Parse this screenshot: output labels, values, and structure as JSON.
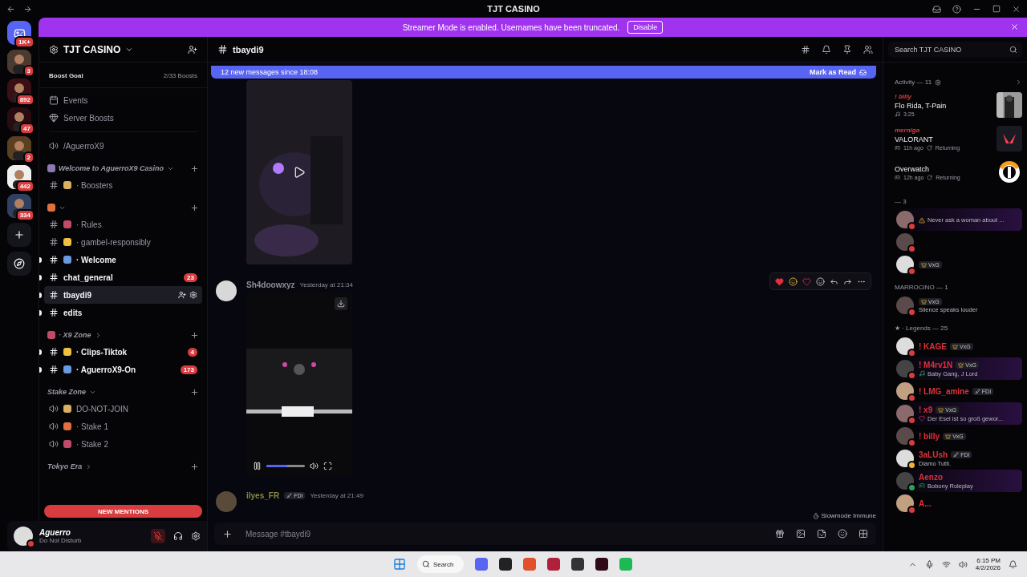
{
  "title_bar": {
    "title": "TJT CASINO"
  },
  "servers": [
    {
      "kind": "home",
      "badge": "1K+"
    },
    {
      "kind": "server",
      "badge": "3"
    },
    {
      "kind": "server",
      "badge": "892"
    },
    {
      "kind": "server",
      "badge": "47"
    },
    {
      "kind": "server",
      "badge": "2"
    },
    {
      "kind": "server",
      "badge": "442"
    },
    {
      "kind": "server",
      "badge": "334"
    },
    {
      "kind": "add"
    },
    {
      "kind": "discover"
    }
  ],
  "banner": {
    "text": "Streamer Mode is enabled. Usernames have been truncated.",
    "button": "Disable"
  },
  "sidebar": {
    "server_name": "TJT CASINO",
    "boost_goal": {
      "label": "Boost Goal",
      "count": "2/33 Boosts"
    },
    "items": [
      {
        "kind": "events",
        "name": "Events"
      },
      {
        "kind": "boosts",
        "name": "Server Boosts"
      },
      {
        "kind": "divider"
      },
      {
        "kind": "stage",
        "name": "/AguerroX9"
      },
      {
        "kind": "category",
        "name": "Welcome to AguerroX9 Casino",
        "emoji": true,
        "expanded": true
      },
      {
        "kind": "text",
        "name": "· Boosters",
        "emoji": true,
        "unread": false,
        "selected": false
      },
      {
        "kind": "category",
        "emoji": true,
        "expanded": true
      },
      {
        "kind": "text",
        "name": "· Rules",
        "emoji": true,
        "unread": false,
        "selected": false
      },
      {
        "kind": "text",
        "name": "· gambel-responsibly",
        "emoji": true,
        "unread": false,
        "selected": false
      },
      {
        "kind": "text",
        "name": "· Welcome",
        "emoji": true,
        "unread": true,
        "selected": false
      },
      {
        "kind": "text",
        "name": "chat_general",
        "emoji": false,
        "unread": true,
        "selected": false,
        "badge": "23"
      },
      {
        "kind": "text",
        "name": "tbaydi9",
        "emoji": false,
        "unread": true,
        "selected": true
      },
      {
        "kind": "text",
        "name": "edits",
        "emoji": false,
        "unread": true,
        "selected": false
      },
      {
        "kind": "category",
        "name": "· X9 Zone",
        "emoji": true,
        "expanded": false
      },
      {
        "kind": "text",
        "name": "· Clips-Tiktok",
        "emoji": true,
        "unread": true,
        "selected": false,
        "badge": "4"
      },
      {
        "kind": "text",
        "name": "· AguerroX9-On",
        "emoji": true,
        "unread": true,
        "selected": false,
        "badge": "173"
      },
      {
        "kind": "category",
        "name": "Stake Zone",
        "emoji": false,
        "expanded": true
      },
      {
        "kind": "voice",
        "name": "DO-NOT-JOIN",
        "emoji": true
      },
      {
        "kind": "voice",
        "name": "· Stake 1",
        "emoji": true
      },
      {
        "kind": "voice",
        "name": "· Stake 2",
        "emoji": true
      },
      {
        "kind": "category",
        "name": "Tokyo Era",
        "emoji": false,
        "expanded": false
      }
    ],
    "mentions_pill": "NEW MENTIONS"
  },
  "user_panel": {
    "name": "Aguerro",
    "status": "Do Not Disturb",
    "muted": true
  },
  "chat": {
    "channel": "tbaydi9",
    "new_messages": {
      "text": "12 new messages since 18:08",
      "action": "Mark as Read"
    },
    "messages": [
      {
        "kind": "attachment",
        "video": {
          "playing": false
        }
      },
      {
        "kind": "message",
        "author": "Sh4doowxyz",
        "color": "#8e9096",
        "time": "Yesterday at 21:34",
        "hovered": true,
        "video": {
          "playing": true,
          "level": 0.55
        }
      },
      {
        "kind": "message",
        "author": "ilyes_FR",
        "color": "#8a8a3a",
        "tag": "FDI",
        "time": "Yesterday at 21:49",
        "hovered": false
      }
    ],
    "slowmode": "Slowmode Immune",
    "composer": {
      "placeholder": "Message #tbaydi9"
    }
  },
  "members": {
    "search": {
      "placeholder": "Search TJT CASINO"
    },
    "activity": {
      "header": "Activity — 11",
      "items": [
        {
          "kind": "music",
          "user": "! billy",
          "title": "Flo Rida, T-Pain",
          "details": [
            "3:25"
          ]
        },
        {
          "kind": "game",
          "user": "merniga",
          "title": "VALORANT",
          "details": [
            "11h ago",
            "Returning"
          ]
        },
        {
          "kind": "game",
          "title": "Overwatch",
          "details": [
            "12h ago",
            "Returning"
          ]
        }
      ]
    },
    "groups": [
      {
        "name": "— 3",
        "members": [
          {
            "color": "#d83c3e",
            "status": {
              "kind": "warning",
              "text": "Never ask a woman about ..."
            }
          },
          {
            "color": "#d83c3e"
          },
          {
            "color": "#d83c3e",
            "tag": "VxG"
          }
        ]
      },
      {
        "name": "MARROCINO — 1",
        "members": [
          {
            "color": "#d83c3e",
            "tag": "VxG",
            "status": {
              "kind": "custom",
              "text": "Silence speaks louder"
            }
          }
        ]
      },
      {
        "name": "★ · Legends — 25",
        "members": [
          {
            "color": "#d83c3e",
            "name": "! KAGE",
            "tag": "VxG"
          },
          {
            "color": "#d83c3e",
            "name": "! M4rv1N",
            "tag": "VxG",
            "status": {
              "kind": "music",
              "text": "Baby Gang, J Lord"
            }
          },
          {
            "color": "#d83c3e",
            "name": "! LMG_amine",
            "tag": "FDI"
          },
          {
            "color": "#d83c3e",
            "name": "! x9",
            "tag": "VxG",
            "status": {
              "kind": "heart",
              "text": "Der Esel ist so groß gewor..."
            }
          },
          {
            "color": "#d83c3e",
            "name": "! billy",
            "tag": "VxG"
          },
          {
            "color": "#f0b232",
            "name": "3aLUsh",
            "tag": "FDI",
            "status": {
              "kind": "custom",
              "text": "Diamo Tutti."
            }
          },
          {
            "color": "#23a55a",
            "name": "Aenzo",
            "status": {
              "kind": "game",
              "text": "Bobony Roleplay"
            }
          },
          {
            "color": "#d83c3e",
            "name": "A..."
          }
        ]
      }
    ]
  },
  "taskbar": {
    "search": "Search",
    "time": "6:15 PM",
    "date": "4/2/2026"
  }
}
